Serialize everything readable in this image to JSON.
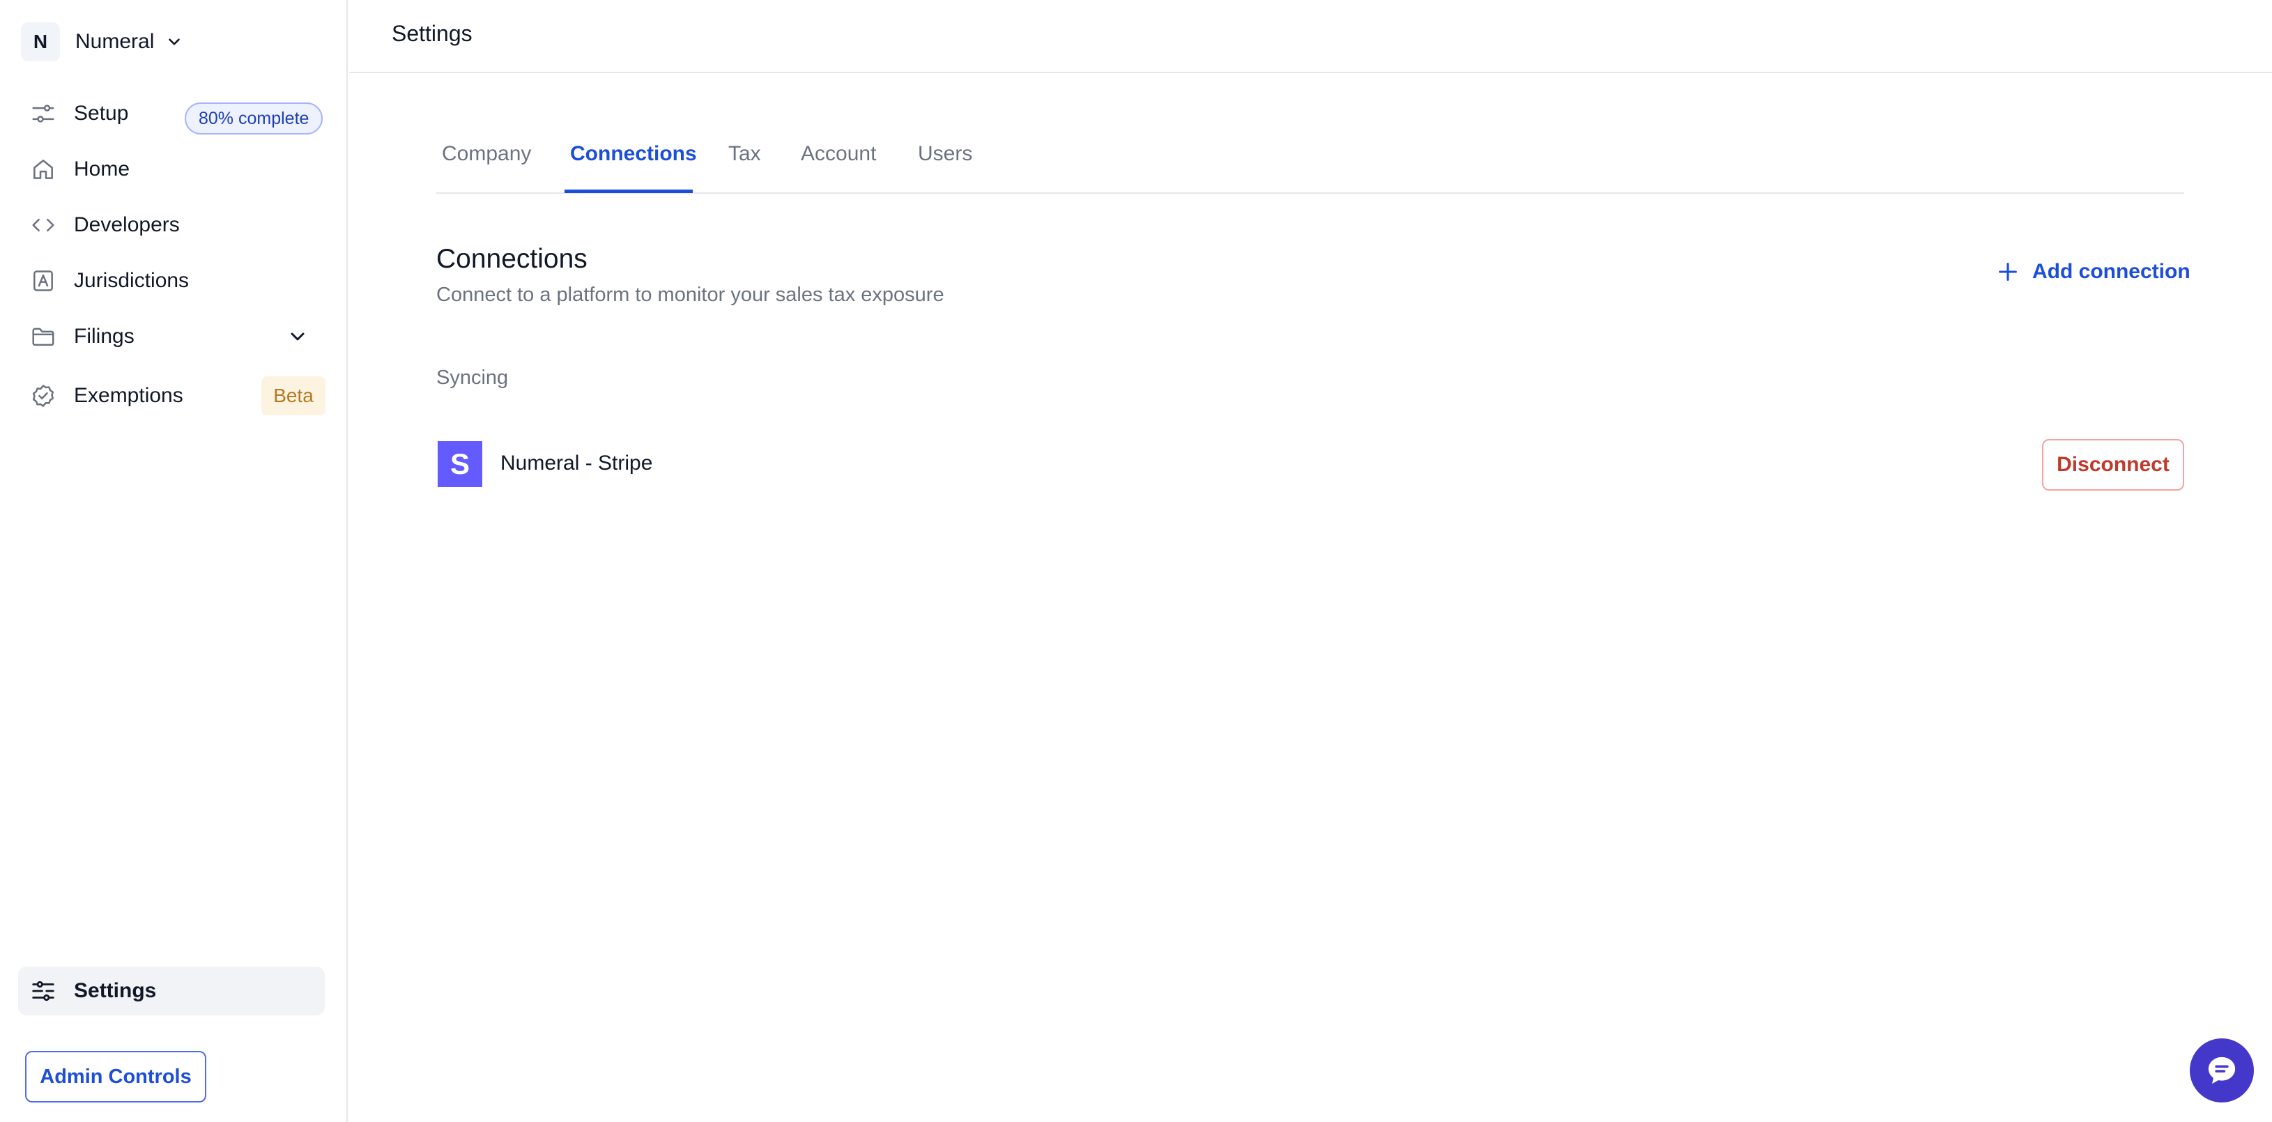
{
  "org": {
    "initial": "N",
    "name": "Numeral"
  },
  "sidebar": {
    "items": [
      {
        "label": "Setup",
        "icon": "sliders-icon",
        "badge": "80% complete"
      },
      {
        "label": "Home",
        "icon": "home-icon"
      },
      {
        "label": "Developers",
        "icon": "code-icon"
      },
      {
        "label": "Jurisdictions",
        "icon": "map-icon"
      },
      {
        "label": "Filings",
        "icon": "folder-icon"
      },
      {
        "label": "Exemptions",
        "icon": "badge-check-icon",
        "badge": "Beta"
      }
    ],
    "settings_label": "Settings",
    "admin_label": "Admin Controls"
  },
  "header": {
    "title": "Settings"
  },
  "tabs": [
    {
      "label": "Company",
      "active": false
    },
    {
      "label": "Connections",
      "active": true
    },
    {
      "label": "Tax",
      "active": false
    },
    {
      "label": "Account",
      "active": false
    },
    {
      "label": "Users",
      "active": false
    }
  ],
  "section": {
    "title": "Connections",
    "description": "Connect to a platform to monitor your sales tax exposure",
    "add_label": "Add connection"
  },
  "groups": [
    {
      "label": "Syncing",
      "connections": [
        {
          "name": "Numeral - Stripe",
          "logo_letter": "S",
          "action_label": "Disconnect"
        }
      ]
    }
  ],
  "colors": {
    "accent": "#1d4ed8",
    "stripe": "#635bff",
    "danger": "#c0392b",
    "beta_bg": "#fdf3e1",
    "beta_text": "#b7791f"
  }
}
